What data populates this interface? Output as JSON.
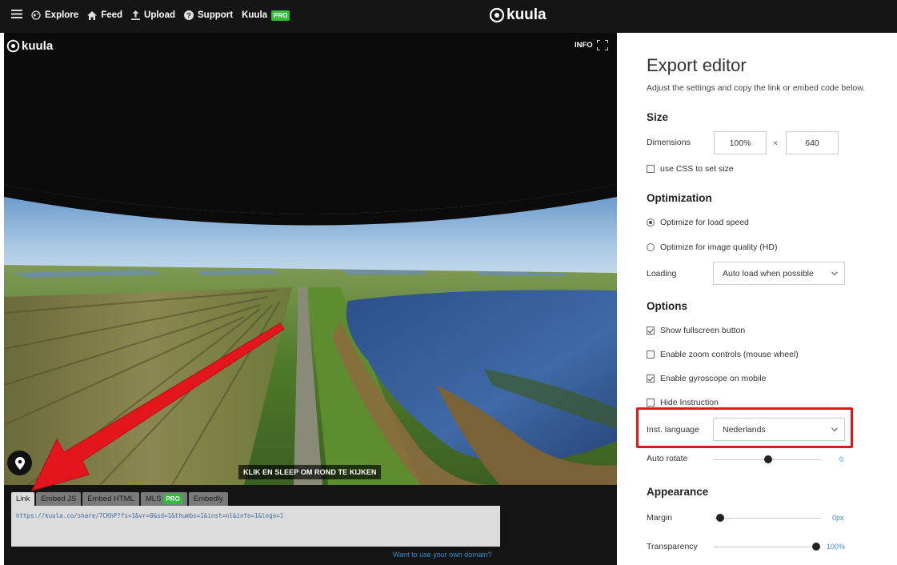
{
  "topbar": {
    "nav": [
      {
        "label": "Explore",
        "icon": "globe-icon"
      },
      {
        "label": "Feed",
        "icon": "home-icon"
      },
      {
        "label": "Upload",
        "icon": "upload-icon"
      },
      {
        "label": "Support",
        "icon": "help-icon"
      }
    ],
    "account": {
      "label": "Kuula",
      "badge": "PRO"
    },
    "brand": "kuula"
  },
  "viewer": {
    "brand": "kuula",
    "info_label": "INFO",
    "instruction": "KLIK EN SLEEP OM ROND TE KIJKEN",
    "tabs": [
      {
        "label": "Link",
        "active": true
      },
      {
        "label": "Embed JS",
        "active": false
      },
      {
        "label": "Embed HTML",
        "active": false
      },
      {
        "label": "MLS",
        "badge": "PRO",
        "active": false
      },
      {
        "label": "Embedly",
        "active": false
      }
    ],
    "share_url": "https://kuula.co/share/7CKhP?fs=1&vr=0&sd=1&thumbs=1&inst=nl&info=1&logo=1",
    "own_domain_link": "Want to use your own domain?"
  },
  "editor": {
    "title": "Export editor",
    "subtitle": "Adjust the settings and copy the link or embed code below.",
    "size": {
      "heading": "Size",
      "dimensions_label": "Dimensions",
      "width_value": "100%",
      "times": "×",
      "height_value": "640",
      "css_option": {
        "label": "use CSS to set size",
        "checked": false
      }
    },
    "optimization": {
      "heading": "Optimization",
      "options": [
        {
          "label": "Optimize for load speed",
          "selected": true
        },
        {
          "label": "Optimize for image quality (HD)",
          "selected": false
        }
      ],
      "loading_label": "Loading",
      "loading_value": "Auto load when possible"
    },
    "options": {
      "heading": "Options",
      "checkboxes": [
        {
          "label": "Show fullscreen button",
          "checked": true
        },
        {
          "label": "Enable zoom controls (mouse wheel)",
          "checked": false
        },
        {
          "label": "Enable gyroscope on mobile",
          "checked": true
        },
        {
          "label": "Hide Instruction",
          "checked": false
        }
      ],
      "language_label": "Inst. language",
      "language_value": "Nederlands",
      "auto_rotate_label": "Auto rotate",
      "auto_rotate_value": "0",
      "auto_rotate_level": 0.5
    },
    "appearance": {
      "heading": "Appearance",
      "margin_label": "Margin",
      "margin_value": "0px",
      "margin_level": 0.0,
      "transparency_label": "Transparency",
      "transparency_value": "100%",
      "transparency_level": 1.0
    }
  },
  "colors": {
    "topbar": "#151515",
    "pro_badge": "#2fbf36",
    "highlight": "#e3151d",
    "link": "#3a8fd0"
  }
}
